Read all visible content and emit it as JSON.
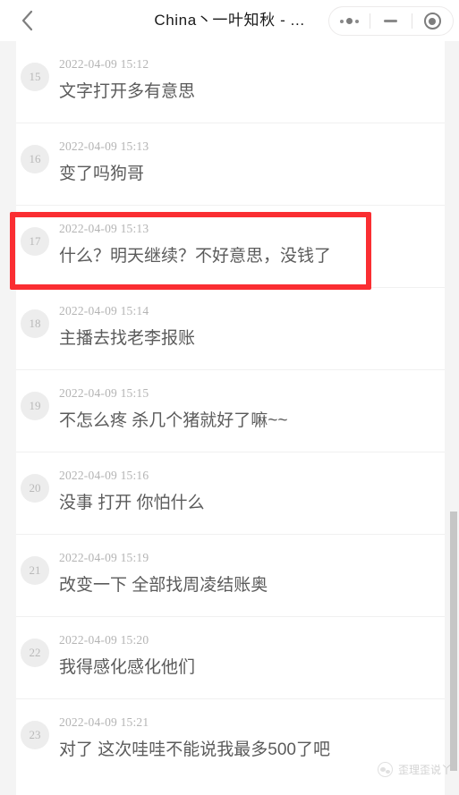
{
  "window": {
    "title": "China丶一叶知秋 - ...",
    "back_icon": "chevron-left-icon",
    "controls": [
      {
        "name": "more-options-button",
        "icon": "three-dots-icon",
        "label": ""
      },
      {
        "name": "minimize-button",
        "icon": "minus-icon",
        "label": ""
      },
      {
        "name": "record-button",
        "icon": "circle-dot-icon",
        "label": ""
      }
    ]
  },
  "messages": [
    {
      "index": "15",
      "time": "2022-04-09 15:12",
      "text": "文字打开多有意思"
    },
    {
      "index": "16",
      "time": "2022-04-09 15:13",
      "text": "变了吗狗哥"
    },
    {
      "index": "17",
      "time": "2022-04-09 15:13",
      "text": "什么？明天继续？不好意思，没钱了"
    },
    {
      "index": "18",
      "time": "2022-04-09 15:14",
      "text": "主播去找老李报账"
    },
    {
      "index": "19",
      "time": "2022-04-09 15:15",
      "text": "不怎么疼 杀几个猪就好了嘛~~"
    },
    {
      "index": "20",
      "time": "2022-04-09 15:16",
      "text": "没事 打开 你怕什么"
    },
    {
      "index": "21",
      "time": "2022-04-09 15:19",
      "text": "改变一下 全部找周凌结账奥"
    },
    {
      "index": "22",
      "time": "2022-04-09 15:20",
      "text": "我得感化感化他们"
    },
    {
      "index": "23",
      "time": "2022-04-09 15:21",
      "text": "对了 这次哇哇不能说我最多500了吧"
    }
  ],
  "annotation": {
    "highlight_color": "#fa2e32",
    "highlight_target_index": "17"
  },
  "watermark": {
    "text": "歪理歪说丫",
    "icon": "wechat-logo-icon"
  },
  "scrollbar": {
    "color": "#c6c6c6"
  }
}
